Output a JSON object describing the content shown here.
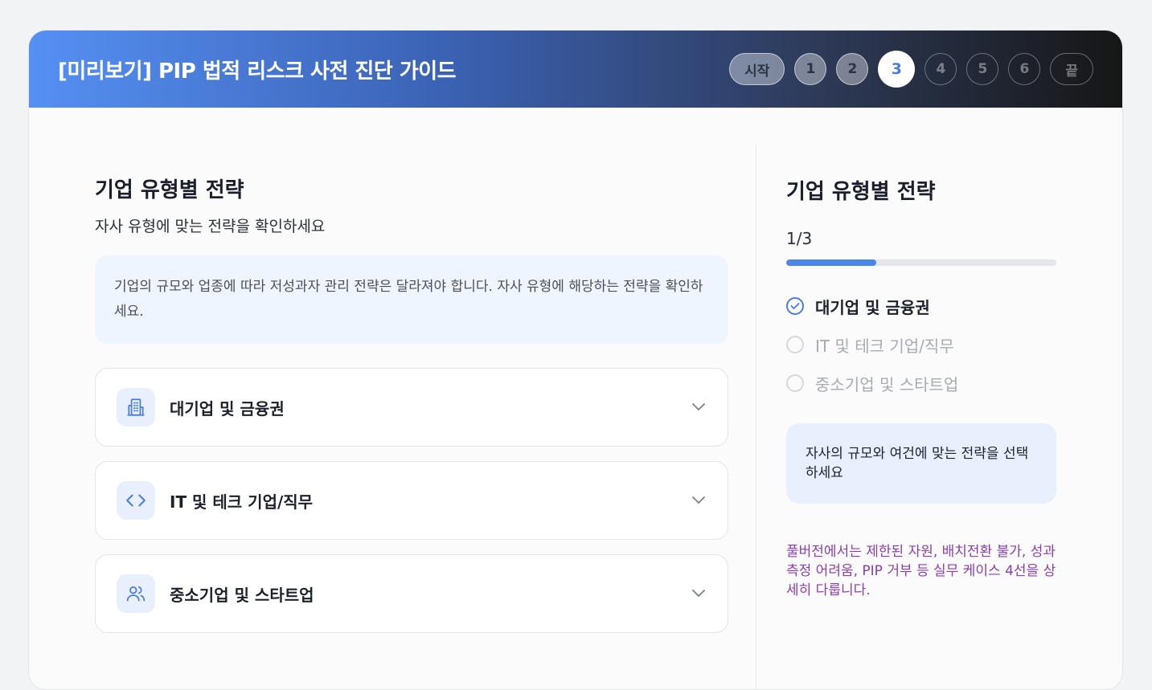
{
  "header": {
    "title": "[미리보기] PIP 법적 리스크 사전 진단 가이드",
    "steps": {
      "start": "시작",
      "s1": "1",
      "s2": "2",
      "s3": "3",
      "s4": "4",
      "s5": "5",
      "s6": "6",
      "end": "끝"
    },
    "current_step": "3"
  },
  "main": {
    "title": "기업 유형별 전략",
    "subtitle": "자사 유형에 맞는 전략을 확인하세요",
    "info": "기업의 규모와 업종에 따라 저성과자 관리 전략은 달라져야 합니다. 자사 유형에 해당하는 전략을 확인하세요.",
    "accordions": [
      {
        "label": "대기업 및 금융권",
        "icon": "building-icon"
      },
      {
        "label": "IT 및 테크 기업/직무",
        "icon": "code-icon"
      },
      {
        "label": "중소기업 및 스타트업",
        "icon": "users-icon"
      }
    ]
  },
  "sidebar": {
    "title": "기업 유형별 전략",
    "progress_text": "1/3",
    "progress_fraction": 0.333,
    "items": [
      {
        "label": "대기업 및 금융권",
        "state": "active"
      },
      {
        "label": "IT 및 테크 기업/직무",
        "state": "inactive"
      },
      {
        "label": "중소기업 및 스타트업",
        "state": "inactive"
      }
    ],
    "hint": "자사의 규모와 여건에 맞는 전략을 선택하세요",
    "promo": "풀버전에서는 제한된 자원, 배치전환 불가, 성과 측정 어려움, PIP 거부 등 실무 케이스 4선을 상세히 다룹니다."
  },
  "colors": {
    "accent": "#4a86e8",
    "promo": "#8a3fae"
  }
}
